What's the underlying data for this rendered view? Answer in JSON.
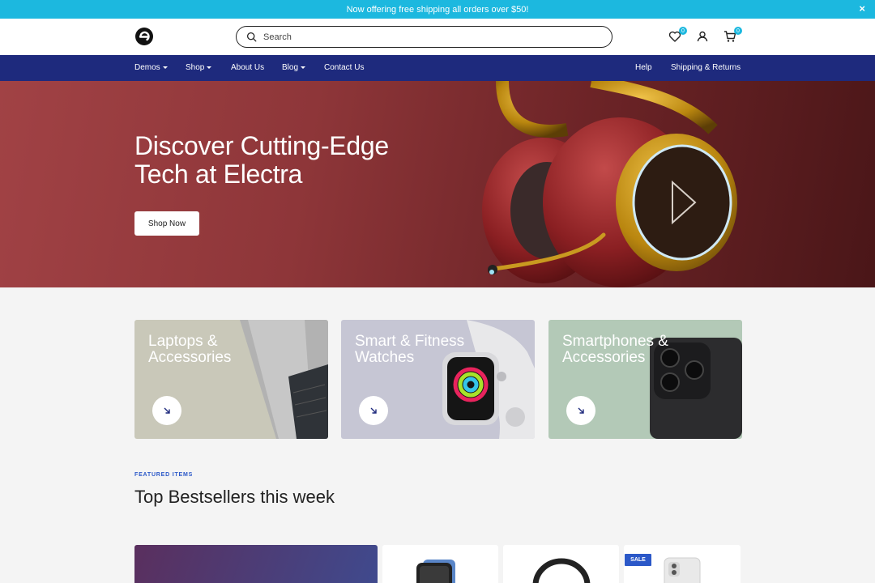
{
  "announcement": {
    "text": "Now offering free shipping all orders over $50!",
    "close": "×"
  },
  "header": {
    "search_placeholder": "Search",
    "wishlist_count": "0",
    "cart_count": "0"
  },
  "nav": {
    "left": [
      {
        "label": "Demos",
        "dropdown": true
      },
      {
        "label": "Shop",
        "dropdown": true
      },
      {
        "label": "About Us",
        "dropdown": false
      },
      {
        "label": "Blog",
        "dropdown": true
      },
      {
        "label": "Contact Us",
        "dropdown": false
      }
    ],
    "right": [
      {
        "label": "Help"
      },
      {
        "label": "Shipping & Returns"
      }
    ]
  },
  "hero": {
    "title": "Discover Cutting-Edge Tech at Electra",
    "button": "Shop Now"
  },
  "categories": [
    {
      "title_line1": "Laptops &",
      "title_line2": "Accessories",
      "bg": "#c9c8b9"
    },
    {
      "title_line1": "Smart & Fitness",
      "title_line2": "Watches",
      "bg": "#c6c6d4"
    },
    {
      "title_line1": "Smartphones &",
      "title_line2": "Accessories",
      "bg": "#b3c9b7"
    }
  ],
  "featured": {
    "eyebrow": "FEATURED ITEMS",
    "title": "Top Bestsellers this week",
    "sale_badge": "SALE"
  },
  "colors": {
    "accent": "#1cb8df",
    "nav_bg": "#1e2a7d",
    "hero_bg": "#8e3639",
    "badge_blue": "#2b58c8"
  }
}
